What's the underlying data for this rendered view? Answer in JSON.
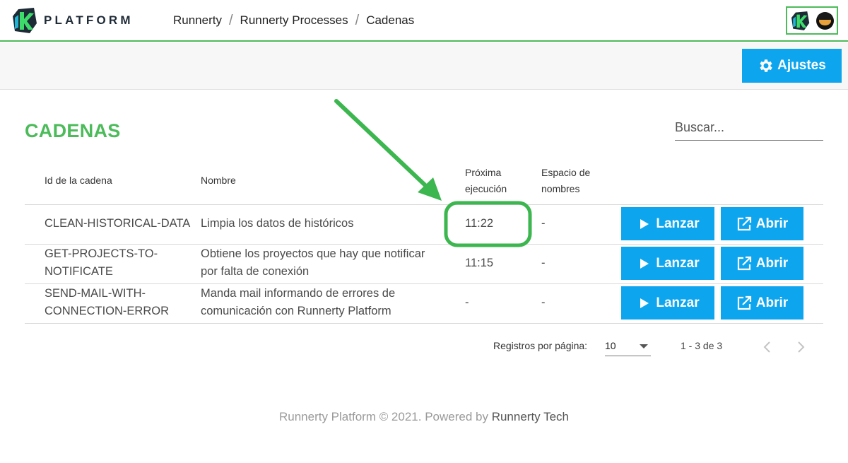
{
  "header": {
    "brand": "PLATFORM",
    "breadcrumbs": [
      "Runnerty",
      "Runnerty Processes",
      "Cadenas"
    ],
    "separator": "/"
  },
  "toolbar": {
    "settings_label": "Ajustes"
  },
  "page": {
    "title": "CADENAS"
  },
  "search": {
    "placeholder": "Buscar..."
  },
  "table": {
    "columns": {
      "id": "Id de la cadena",
      "name": "Nombre",
      "next_run": [
        "Próxima",
        "ejecución"
      ],
      "namespace": [
        "Espacio de",
        "nombres"
      ]
    },
    "rows": [
      {
        "id": [
          "CLEAN-HISTORICAL-DATA"
        ],
        "name": [
          "Limpia los datos de históricos"
        ],
        "next_run": "11:22",
        "namespace": "-"
      },
      {
        "id": [
          "GET-PROJECTS-TO-",
          "NOTIFICATE"
        ],
        "name": [
          "Obtiene los proyectos que hay que notificar",
          "por falta de conexión"
        ],
        "next_run": "11:15",
        "namespace": "-"
      },
      {
        "id": [
          "SEND-MAIL-WITH-",
          "CONNECTION-ERROR"
        ],
        "name": [
          "Manda mail informando de errores de",
          "comunicación con Runnerty Platform"
        ],
        "next_run": "-",
        "namespace": "-"
      }
    ],
    "launch_label": "Lanzar",
    "open_label": "Abrir"
  },
  "pagination": {
    "label": "Registros por página:",
    "page_size": "10",
    "range": "1 - 3 de 3"
  },
  "footer": {
    "text": "Runnerty Platform © 2021. Powered by ",
    "link": "Runnerty Tech"
  },
  "colors": {
    "accent_green": "#4cbb5a",
    "button_blue": "#0ea5ef"
  }
}
